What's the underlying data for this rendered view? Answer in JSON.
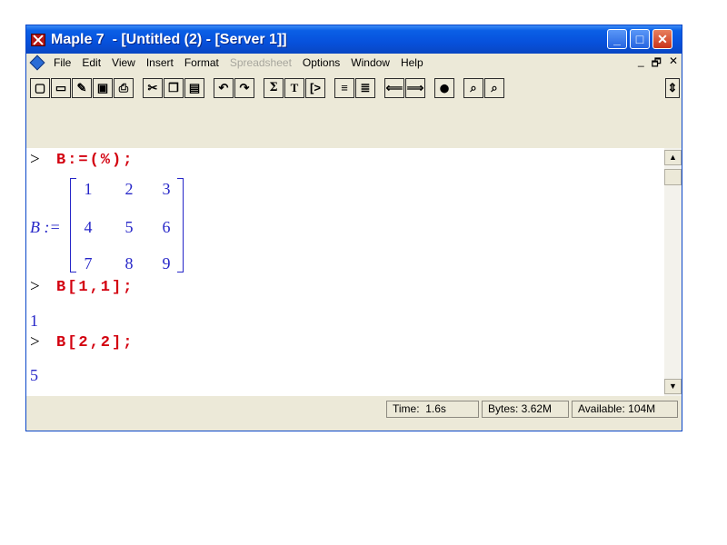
{
  "title": "Maple 7  - [Untitled (2) - [Server 1]]",
  "window_buttons": {
    "minimize": "_",
    "maximize": "□",
    "close": "✕"
  },
  "menu": [
    {
      "label": "File"
    },
    {
      "label": "Edit"
    },
    {
      "label": "View"
    },
    {
      "label": "Insert"
    },
    {
      "label": "Format"
    },
    {
      "label": "Spreadsheet",
      "disabled": true
    },
    {
      "label": "Options"
    },
    {
      "label": "Window"
    },
    {
      "label": "Help"
    }
  ],
  "mdi_buttons": [
    "_",
    "🗗",
    "✕"
  ],
  "toolbar_icons": [
    "new-icon",
    "open-icon",
    "open-url-icon",
    "save-icon",
    "print-icon",
    "cut-icon",
    "copy-icon",
    "paste-icon",
    "undo-icon",
    "redo-icon",
    "sigma-icon",
    "text-icon",
    "prompt-icon",
    "collapse-icon",
    "expand-icon",
    "back-icon",
    "forward-icon",
    "stop-icon",
    "zoom-in-icon",
    "zoom-out-icon"
  ],
  "worksheet": {
    "prompt": ">",
    "commands": [
      "B:=(%);",
      "B[1,1];",
      "B[2,2];"
    ],
    "matrix_label": "B :=",
    "matrix": [
      [
        "1",
        "2",
        "3"
      ],
      [
        "4",
        "5",
        "6"
      ],
      [
        "7",
        "8",
        "9"
      ]
    ],
    "outputs": [
      "1",
      "5"
    ]
  },
  "status": {
    "time": "Time:  1.6s",
    "bytes": "Bytes: 3.62M",
    "available": "Available: 104M"
  }
}
